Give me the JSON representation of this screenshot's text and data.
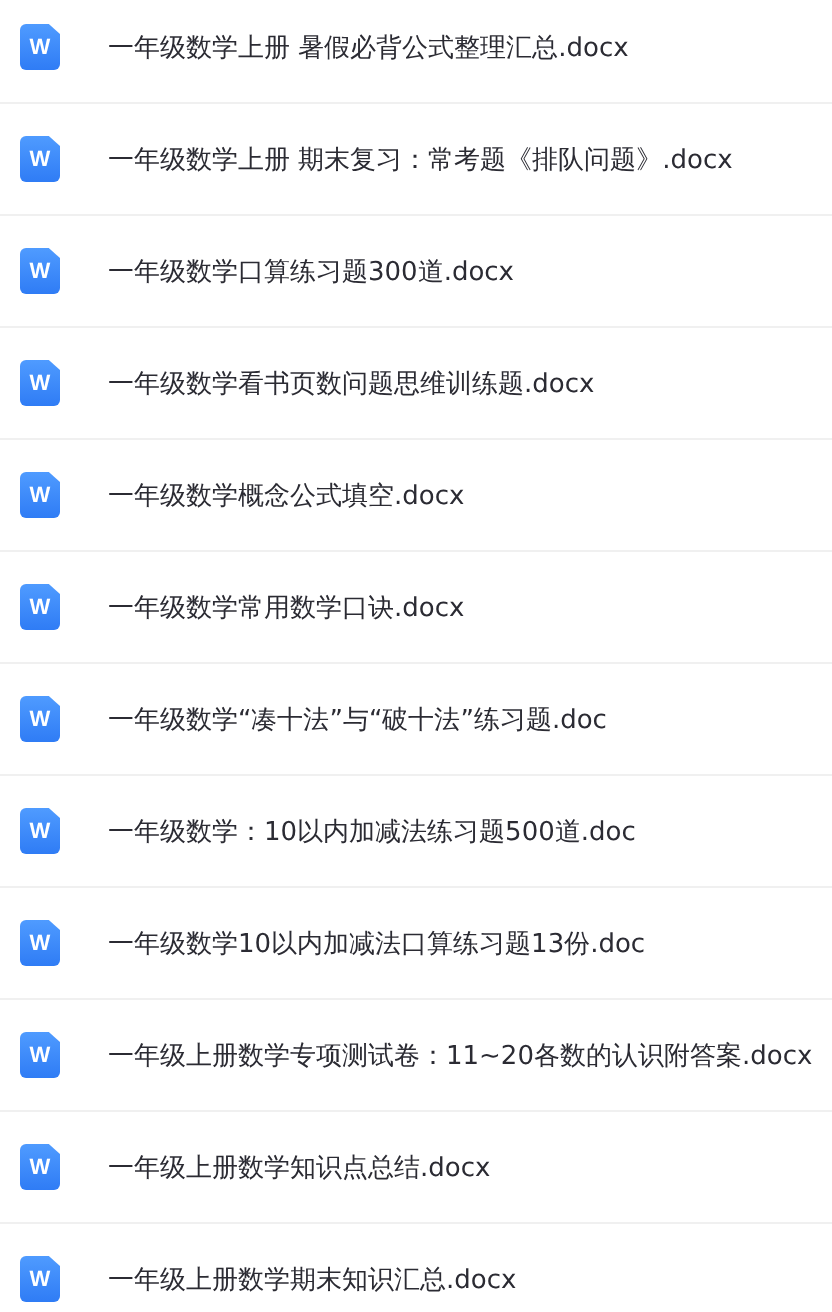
{
  "files": [
    {
      "icon": "W",
      "name": "一年级数学上册 暑假必背公式整理汇总.docx"
    },
    {
      "icon": "W",
      "name": "一年级数学上册 期末复习：常考题《排队问题》.docx"
    },
    {
      "icon": "W",
      "name": "一年级数学口算练习题300道.docx"
    },
    {
      "icon": "W",
      "name": "一年级数学看书页数问题思维训练题.docx"
    },
    {
      "icon": "W",
      "name": "一年级数学概念公式填空.docx"
    },
    {
      "icon": "W",
      "name": "一年级数学常用数学口诀.docx"
    },
    {
      "icon": "W",
      "name": "一年级数学“凑十法”与“破十法”练习题.doc"
    },
    {
      "icon": "W",
      "name": "一年级数学：10以内加减法练习题500道.doc"
    },
    {
      "icon": "W",
      "name": "一年级数学10以内加减法口算练习题13份.doc"
    },
    {
      "icon": "W",
      "name": "一年级上册数学专项测试卷：11~20各数的认识附答案.docx"
    },
    {
      "icon": "W",
      "name": "一年级上册数学知识点总结.docx"
    },
    {
      "icon": "W",
      "name": "一年级上册数学期末知识汇总.docx"
    }
  ]
}
